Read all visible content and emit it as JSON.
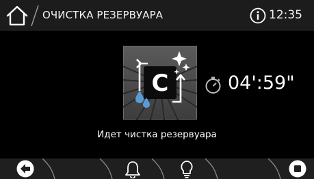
{
  "header": {
    "title": "ОЧИСТКА РЕЗЕРВУАРА",
    "time": "12:35"
  },
  "main": {
    "program_icon_letter": "C",
    "timer": "04':59\"",
    "status": "Идет чистка резервуара"
  },
  "footer": {
    "buttons": [
      "back-icon",
      "bell-icon",
      "lightbulb-icon",
      "stop-icon"
    ]
  },
  "colors": {
    "header_bg": "#1c1c1c",
    "footer_bg": "#1f1f1f",
    "background": "#000000",
    "water_drops": "#5a9bd5",
    "text": "#ffffff"
  }
}
